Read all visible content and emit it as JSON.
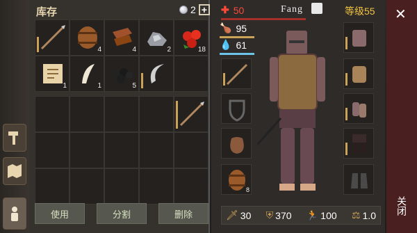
{
  "inventory": {
    "title": "库存",
    "currency": "2",
    "items_top": [
      {
        "icon": "spear-icon",
        "qty": ""
      },
      {
        "icon": "barrel-icon",
        "qty": "4"
      },
      {
        "icon": "leather-icon",
        "qty": "4"
      },
      {
        "icon": "iron-ore-icon",
        "qty": "2"
      },
      {
        "icon": "berries-icon",
        "qty": "18"
      },
      {
        "icon": "map-scroll-icon",
        "qty": "1"
      },
      {
        "icon": "tooth-icon",
        "qty": "1"
      },
      {
        "icon": "coal-icon",
        "qty": "5"
      },
      {
        "icon": "sickle-icon",
        "qty": ""
      },
      {
        "icon": "empty",
        "qty": ""
      }
    ],
    "buttons": {
      "use": "使用",
      "split": "分割",
      "delete": "删除"
    }
  },
  "character": {
    "hp": "50",
    "name": "Fang",
    "level": "等级55",
    "food": "95",
    "water": "61",
    "bottom": {
      "attack": "30",
      "armor": "370",
      "speed": "100",
      "weight": "1.0"
    }
  },
  "close": {
    "label": "关闭"
  },
  "colors": {
    "hp": "#ff4a3a",
    "level": "#f3c440",
    "food": "#caa258",
    "water": "#6cc4e8"
  }
}
